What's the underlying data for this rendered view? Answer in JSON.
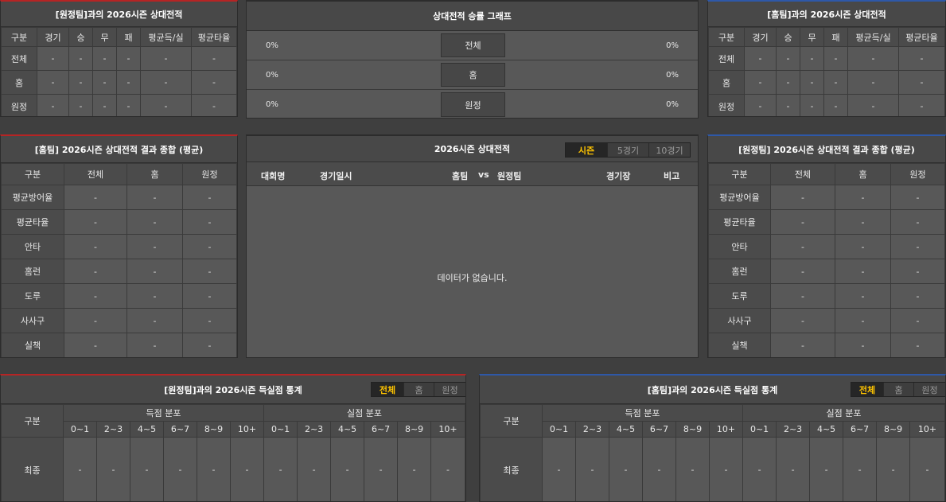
{
  "p1": {
    "title": "[원정팀]과의 2026시즌 상대전적",
    "headers": [
      "구분",
      "경기",
      "승",
      "무",
      "패",
      "평균득/실",
      "평균타율"
    ],
    "rows": [
      {
        "label": "전체",
        "cells": [
          "-",
          "-",
          "-",
          "-",
          "-",
          "-"
        ]
      },
      {
        "label": "홈",
        "cells": [
          "-",
          "-",
          "-",
          "-",
          "-",
          "-"
        ]
      },
      {
        "label": "원정",
        "cells": [
          "-",
          "-",
          "-",
          "-",
          "-",
          "-"
        ]
      }
    ]
  },
  "graph": {
    "title": "상대전적 승률 그래프",
    "rows": [
      {
        "label": "전체",
        "left": "0%",
        "right": "0%"
      },
      {
        "label": "홈",
        "left": "0%",
        "right": "0%"
      },
      {
        "label": "원정",
        "left": "0%",
        "right": "0%"
      }
    ]
  },
  "p3": {
    "title": "[홈팀]과의 2026시즌 상대전적",
    "headers": [
      "구분",
      "경기",
      "승",
      "무",
      "패",
      "평균득/실",
      "평균타율"
    ],
    "rows": [
      {
        "label": "전체",
        "cells": [
          "-",
          "-",
          "-",
          "-",
          "-",
          "-"
        ]
      },
      {
        "label": "홈",
        "cells": [
          "-",
          "-",
          "-",
          "-",
          "-",
          "-"
        ]
      },
      {
        "label": "원정",
        "cells": [
          "-",
          "-",
          "-",
          "-",
          "-",
          "-"
        ]
      }
    ]
  },
  "s1": {
    "title": "[홈팀] 2026시즌 상대전적 결과 종합 (평균)",
    "headers": [
      "구분",
      "전체",
      "홈",
      "원정"
    ],
    "rows": [
      {
        "label": "평균방어율",
        "cells": [
          "-",
          "-",
          "-"
        ]
      },
      {
        "label": "평균타율",
        "cells": [
          "-",
          "-",
          "-"
        ]
      },
      {
        "label": "안타",
        "cells": [
          "-",
          "-",
          "-"
        ]
      },
      {
        "label": "홈런",
        "cells": [
          "-",
          "-",
          "-"
        ]
      },
      {
        "label": "도루",
        "cells": [
          "-",
          "-",
          "-"
        ]
      },
      {
        "label": "사사구",
        "cells": [
          "-",
          "-",
          "-"
        ]
      },
      {
        "label": "실책",
        "cells": [
          "-",
          "-",
          "-"
        ]
      }
    ]
  },
  "record": {
    "title": "2026시즌 상대전적",
    "tabs": [
      "시즌",
      "5경기",
      "10경기"
    ],
    "active_tab": "시즌",
    "headers": {
      "competition": "대회명",
      "date": "경기일시",
      "home": "홈팀",
      "vs": "vs",
      "away": "원정팀",
      "stadium": "경기장",
      "note": "비고"
    },
    "empty": "데이터가 없습니다."
  },
  "s2": {
    "title": "[원정팀] 2026시즌 상대전적 결과 종합 (평균)",
    "headers": [
      "구분",
      "전체",
      "홈",
      "원정"
    ],
    "rows": [
      {
        "label": "평균방어율",
        "cells": [
          "-",
          "-",
          "-"
        ]
      },
      {
        "label": "평균타율",
        "cells": [
          "-",
          "-",
          "-"
        ]
      },
      {
        "label": "안타",
        "cells": [
          "-",
          "-",
          "-"
        ]
      },
      {
        "label": "홈런",
        "cells": [
          "-",
          "-",
          "-"
        ]
      },
      {
        "label": "도루",
        "cells": [
          "-",
          "-",
          "-"
        ]
      },
      {
        "label": "사사구",
        "cells": [
          "-",
          "-",
          "-"
        ]
      },
      {
        "label": "실책",
        "cells": [
          "-",
          "-",
          "-"
        ]
      }
    ]
  },
  "score_away": {
    "title": "[원정팀]과의 2026시즌 득실점 통계",
    "tabs": [
      "전체",
      "홈",
      "원정"
    ],
    "active_tab": "전체",
    "col_label": "구분",
    "scored_label": "득점 분포",
    "conceded_label": "실점 분포",
    "ranges": [
      "0~1",
      "2~3",
      "4~5",
      "6~7",
      "8~9",
      "10+"
    ],
    "row_label": "최종",
    "scored": [
      "-",
      "-",
      "-",
      "-",
      "-",
      "-"
    ],
    "conceded": [
      "-",
      "-",
      "-",
      "-",
      "-",
      "-"
    ]
  },
  "score_home": {
    "title": "[홈팀]과의 2026시즌 득실점 통계",
    "tabs": [
      "전체",
      "홈",
      "원정"
    ],
    "active_tab": "전체",
    "col_label": "구분",
    "scored_label": "득점 분포",
    "conceded_label": "실점 분포",
    "ranges": [
      "0~1",
      "2~3",
      "4~5",
      "6~7",
      "8~9",
      "10+"
    ],
    "row_label": "최종",
    "scored": [
      "-",
      "-",
      "-",
      "-",
      "-",
      "-"
    ],
    "conceded": [
      "-",
      "-",
      "-",
      "-",
      "-",
      "-"
    ]
  },
  "colors": {
    "away_accent": "#b62424",
    "home_accent": "#2e58a8",
    "active_tab_text": "#ffc400"
  }
}
